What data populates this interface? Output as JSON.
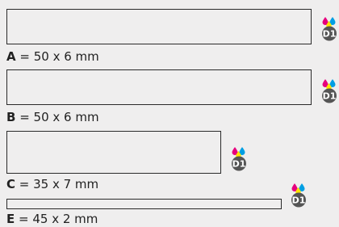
{
  "colors": {
    "background": "#efeeee",
    "box_border": "#2a2a2a",
    "text": "#222222",
    "badge_circle": "#555555",
    "badge_text": "#ffffff",
    "drop_magenta": "#e6007e",
    "drop_cyan": "#009fe3",
    "drop_yellow": "#ffe500"
  },
  "badge_text": "D1",
  "items": [
    {
      "letter": "A",
      "text": " = 50 x 6 mm"
    },
    {
      "letter": "B",
      "text": " = 50 x 6 mm"
    },
    {
      "letter": "C",
      "text": " = 35 x 7 mm"
    },
    {
      "letter": "E",
      "text": " = 45 x 2 mm"
    }
  ]
}
